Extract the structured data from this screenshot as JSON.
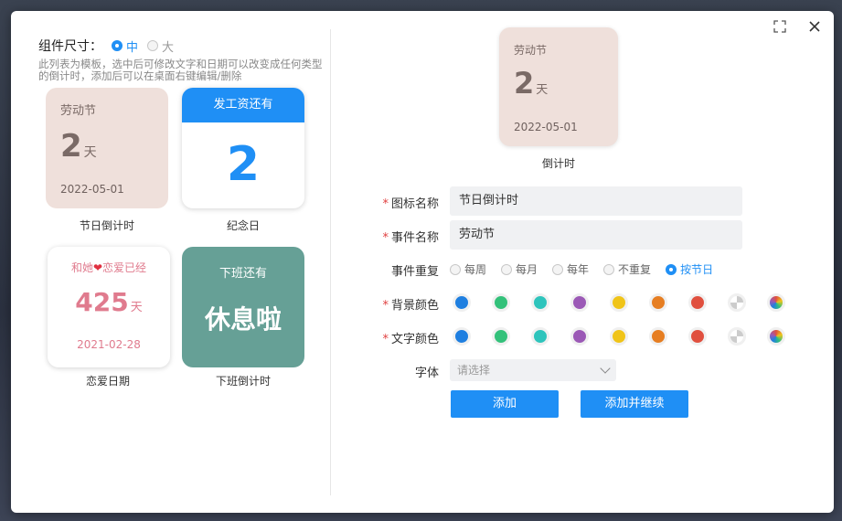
{
  "left": {
    "size_label": "组件尺寸：",
    "size_options": [
      {
        "label": "中",
        "selected": true
      },
      {
        "label": "大",
        "selected": false
      }
    ],
    "hint": "此列表为模板，选中后可修改文字和日期可以改变成任何类型的倒计时，添加后可以在桌面右键编辑/删除",
    "cards": [
      {
        "title": "劳动节",
        "number": "2",
        "unit": "天",
        "date": "2022-05-01",
        "caption": "节日倒计时"
      },
      {
        "header": "发工资还有",
        "number": "2",
        "caption": "纪念日"
      },
      {
        "title_prefix": "和她",
        "heart": "❤",
        "title_suffix": "恋爱已经",
        "number": "425",
        "unit": "天",
        "date": "2021-02-28",
        "caption": "恋爱日期"
      },
      {
        "title": "下班还有",
        "text": "休息啦",
        "caption": "下班倒计时"
      }
    ]
  },
  "preview": {
    "title": "劳动节",
    "number": "2",
    "unit": "天",
    "date": "2022-05-01",
    "caption": "倒计时"
  },
  "form": {
    "icon_name": {
      "label": "图标名称",
      "value": "节日倒计时"
    },
    "event_name": {
      "label": "事件名称",
      "value": "劳动节"
    },
    "repeat": {
      "label": "事件重复",
      "options": [
        "每周",
        "每月",
        "每年",
        "不重复",
        "按节日"
      ],
      "selected": "按节日"
    },
    "bg_color": {
      "label": "背景颜色"
    },
    "text_color": {
      "label": "文字颜色"
    },
    "swatch_colors": [
      "#1f7fe0",
      "#33c17a",
      "#2ec4bc",
      "#9b59b6",
      "#f0c419",
      "#e67e22",
      "#e0503f",
      "#cccccc",
      "rainbow"
    ],
    "font": {
      "label": "字体",
      "placeholder": "请选择"
    },
    "add_button": "添加",
    "add_continue_button": "添加并继续"
  },
  "colors": {
    "accent": "#1f8ff5",
    "card_bg": "#efe0db",
    "green_card": "#66a096",
    "pink": "#e07b8e"
  }
}
